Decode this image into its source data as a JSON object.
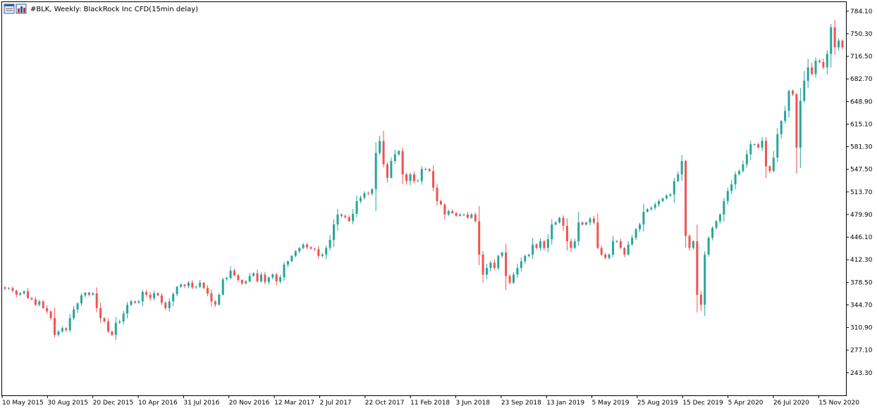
{
  "header": {
    "title": "#BLK, Weekly:  BlackRock Inc CFD(15min delay)",
    "icons": [
      "table-icon",
      "chart-icon"
    ]
  },
  "colors": {
    "up": "#26a69a",
    "down": "#ef5350",
    "frame": "#000000",
    "background": "#ffffff"
  },
  "chart_data": {
    "type": "candlestick",
    "grid": false,
    "ylim": [
      209.5,
      797.6
    ],
    "yticks": [
      "784.10",
      "750.30",
      "716.50",
      "682.70",
      "648.90",
      "615.10",
      "581.30",
      "547.50",
      "513.70",
      "479.90",
      "446.10",
      "412.30",
      "378.50",
      "344.70",
      "310.90",
      "277.10",
      "243.30"
    ],
    "xticks": [
      "10 May 2015",
      "30 Aug 2015",
      "20 Dec 2015",
      "10 Apr 2016",
      "31 Jul 2016",
      "20 Nov 2016",
      "12 Mar 2017",
      "2 Jul 2017",
      "22 Oct 2017",
      "11 Feb 2018",
      "3 Jun 2018",
      "23 Sep 2018",
      "13 Jan 2019",
      "5 May 2019",
      "25 Aug 2019",
      "15 Dec 2019",
      "5 Apr 2020",
      "26 Jul 2020",
      "15 Nov 2020"
    ],
    "series": [
      {
        "close": [
          369,
          370,
          366,
          360,
          362,
          365,
          355,
          353,
          345,
          350,
          340,
          335,
          325,
          300,
          305,
          310,
          307,
          325,
          338,
          347,
          359,
          363,
          360,
          362,
          340,
          325,
          320,
          305,
          300,
          318,
          320,
          332,
          345,
          350,
          348,
          350,
          364,
          360,
          355,
          362,
          359,
          348,
          340,
          350,
          361,
          372,
          375,
          373,
          378,
          371,
          372,
          378,
          370,
          362,
          350,
          345,
          360,
          383,
          385,
          396,
          389,
          382,
          377,
          380,
          388,
          392,
          380,
          390,
          379,
          386,
          390,
          380,
          386,
          405,
          410,
          418,
          425,
          430,
          435,
          431,
          429,
          428,
          418,
          420,
          430,
          442,
          465,
          480,
          478,
          476,
          470,
          481,
          500,
          505,
          512,
          511,
          518,
          572,
          590,
          555,
          535,
          560,
          570,
          575,
          540,
          530,
          540,
          530,
          530,
          548,
          548,
          545,
          520,
          500,
          495,
          480,
          485,
          482,
          478,
          480,
          480,
          475,
          480,
          470,
          420,
          390,
          400,
          408,
          400,
          418,
          423,
          388,
          378,
          390,
          400,
          410,
          418,
          420,
          435,
          430,
          440,
          430,
          443,
          465,
          468,
          475,
          463,
          440,
          430,
          440,
          468,
          465,
          468,
          474,
          468,
          430,
          420,
          415,
          420,
          440,
          440,
          430,
          420,
          435,
          445,
          458,
          465,
          484,
          488,
          490,
          495,
          500,
          504,
          508,
          510,
          530,
          540,
          560,
          448,
          430,
          440,
          360,
          345,
          420,
          445,
          460,
          470,
          480,
          500,
          515,
          525,
          540,
          545,
          555,
          570,
          585,
          585,
          580,
          590,
          552,
          545,
          565,
          600,
          620,
          635,
          665,
          660,
          580,
          650,
          680,
          700,
          690,
          710,
          708,
          700,
          720,
          760,
          730,
          740,
          730
        ]
      }
    ]
  }
}
